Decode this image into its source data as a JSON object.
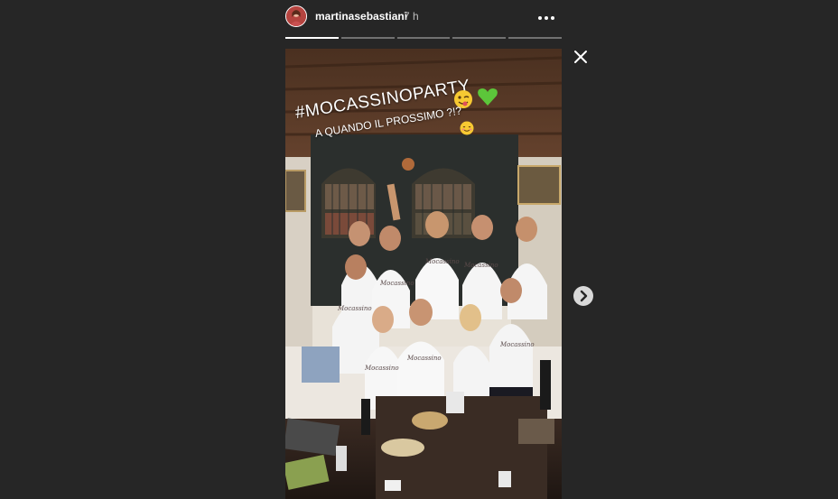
{
  "story": {
    "username": "martinasebastiani",
    "time": "7 h",
    "caption_hashtag": "#MOCASSINOPARTY",
    "caption_text": "A QUANDO IL PROSSIMO ?!?",
    "progress_segments": 5,
    "active_segment": 0
  },
  "colors": {
    "background": "#262626",
    "text": "#ffffff",
    "time": "#bdbdbd"
  },
  "icons": [
    "avatar",
    "more-options-icon",
    "close-icon",
    "next-arrow-icon"
  ]
}
